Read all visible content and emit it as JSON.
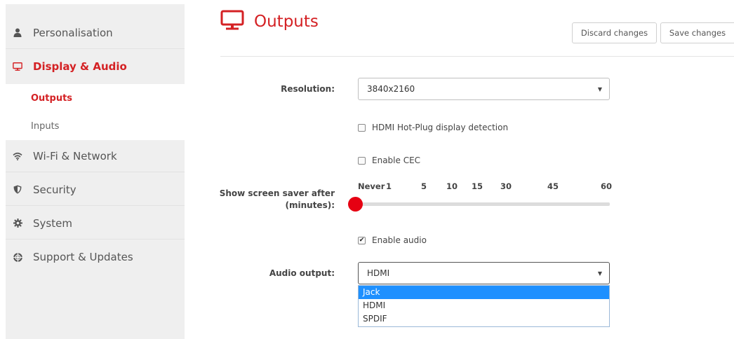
{
  "sidebar": {
    "items": [
      {
        "label": "Personalisation",
        "icon": "person-icon"
      },
      {
        "label": "Display & Audio",
        "icon": "monitor-icon",
        "active": true
      },
      {
        "label": "Wi-Fi & Network",
        "icon": "wifi-icon"
      },
      {
        "label": "Security",
        "icon": "shield-icon"
      },
      {
        "label": "System",
        "icon": "gear-icon"
      },
      {
        "label": "Support & Updates",
        "icon": "lifebuoy-icon"
      }
    ],
    "subitems": [
      {
        "label": "Outputs",
        "active": true
      },
      {
        "label": "Inputs"
      }
    ]
  },
  "header": {
    "title": "Outputs",
    "icon": "monitor-icon",
    "discard_label": "Discard changes",
    "save_label": "Save changes"
  },
  "form": {
    "resolution_label": "Resolution:",
    "resolution_value": "3840x2160",
    "hotplug_label": "HDMI Hot-Plug display detection",
    "hotplug_checked": false,
    "cec_label": "Enable CEC",
    "cec_checked": false,
    "screensaver_label_line1": "Show screen saver after",
    "screensaver_label_line2": "(minutes):",
    "screensaver_ticks": [
      "Never",
      "1",
      "5",
      "10",
      "15",
      "30",
      "45",
      "60"
    ],
    "screensaver_value": "Never",
    "audio_label": "Enable audio",
    "audio_checked": true,
    "audio_output_label": "Audio output:",
    "audio_output_value": "HDMI",
    "audio_output_options": [
      "Jack",
      "HDMI",
      "SPDIF"
    ],
    "audio_output_highlighted": "Jack"
  },
  "colors": {
    "accent": "#d42124",
    "slider_thumb": "#e60012",
    "option_highlight": "#1e90ff"
  }
}
